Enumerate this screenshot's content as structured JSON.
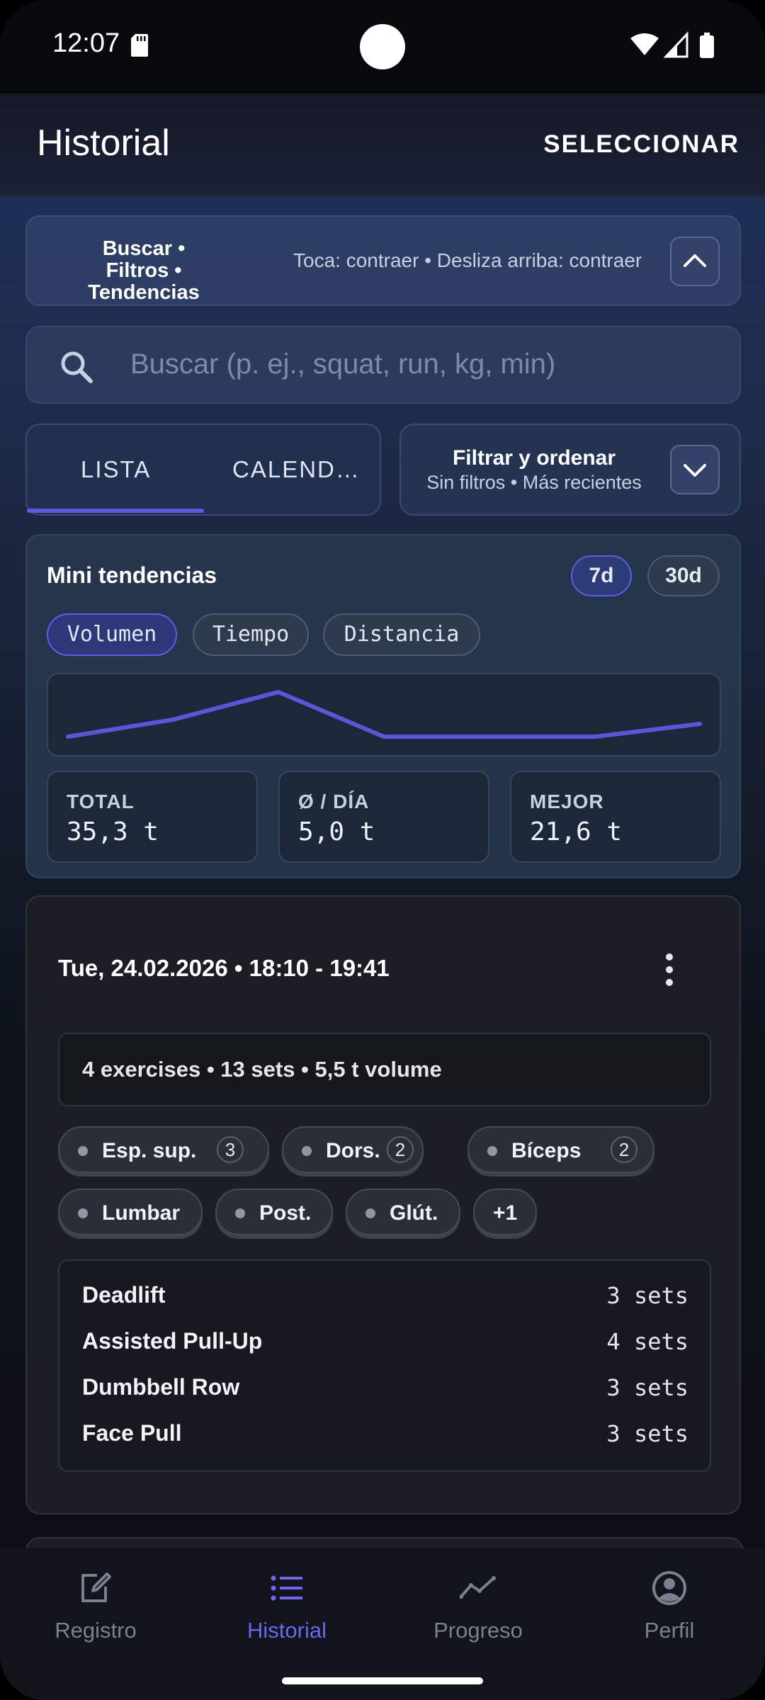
{
  "status_bar": {
    "time": "12:07"
  },
  "app_bar": {
    "title": "Historial",
    "action": "SELECCIONAR"
  },
  "search_strip": {
    "title": "Buscar • Filtros • Tendencias",
    "hint": "Toca: contraer • Desliza arriba: contraer",
    "collapse_icon": "chevron-up-icon"
  },
  "search": {
    "placeholder": "Buscar (p. ej., squat, run, kg, min)"
  },
  "view_tabs": {
    "tabs": [
      "LISTA",
      "CALEND…"
    ],
    "selected": "LISTA"
  },
  "filter": {
    "title": "Filtrar y ordenar",
    "subtitle": "Sin filtros • Más recientes",
    "expand_icon": "chevron-down-icon"
  },
  "mini_trends": {
    "title": "Mini tendencias",
    "ranges": [
      "7d",
      "30d"
    ],
    "selected_range": "7d",
    "metrics": [
      "Volumen",
      "Tiempo",
      "Distancia"
    ],
    "selected_metric": "Volumen",
    "stats": [
      {
        "label": "TOTAL",
        "value": "35,3 t"
      },
      {
        "label": "Ø / DÍA",
        "value": "5,0 t"
      },
      {
        "label": "MEJOR",
        "value": "21,6 t"
      }
    ],
    "accent_color": "#5b55dc"
  },
  "session": {
    "date": "Tue, 24.02.2026 • 18:10 - 19:41",
    "summary": "4 exercises • 13 sets • 5,5 t volume",
    "muscles": [
      {
        "label": "Esp. sup.",
        "count": "3"
      },
      {
        "label": "Dors.",
        "count": "2"
      },
      {
        "label": "Bíceps",
        "count": "2"
      },
      {
        "label": "Lumbar",
        "count": ""
      },
      {
        "label": "Post.",
        "count": ""
      },
      {
        "label": "Glút.",
        "count": ""
      }
    ],
    "more": "+1",
    "exercises": [
      {
        "name": "Deadlift",
        "sets": "3 sets"
      },
      {
        "name": "Assisted Pull-Up",
        "sets": "4 sets"
      },
      {
        "name": "Dumbbell Row",
        "sets": "3 sets"
      },
      {
        "name": "Face Pull",
        "sets": "3 sets"
      }
    ]
  },
  "bottom_nav": {
    "items": [
      {
        "label": "Registro",
        "icon": "edit-icon"
      },
      {
        "label": "Historial",
        "icon": "list-icon"
      },
      {
        "label": "Progreso",
        "icon": "trend-icon"
      },
      {
        "label": "Perfil",
        "icon": "profile-icon"
      }
    ],
    "active": "Historial",
    "active_color": "#6c66f0"
  }
}
